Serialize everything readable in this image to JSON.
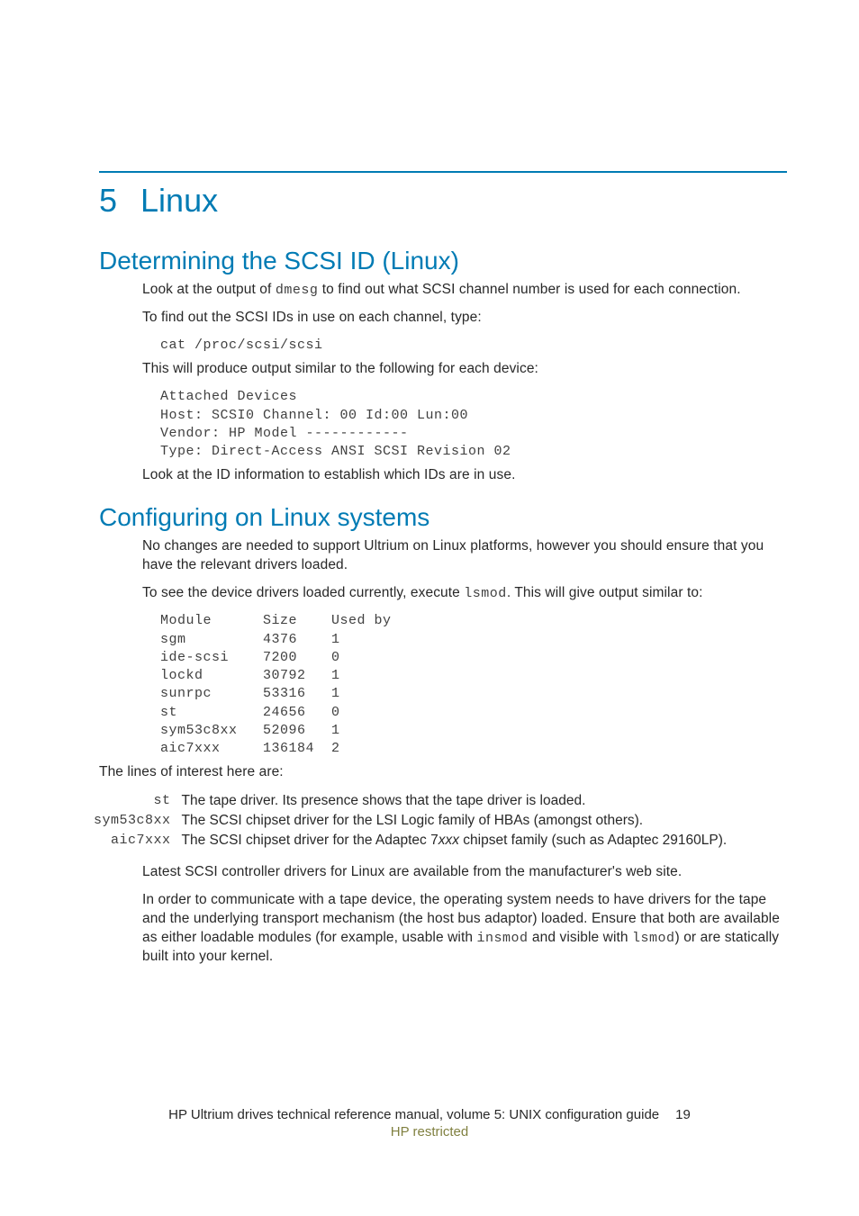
{
  "chapter": {
    "num": "5",
    "title": "Linux"
  },
  "section1": {
    "title": "Determining the SCSI ID (Linux)",
    "p1a": "Look at the output of ",
    "p1code": "dmesg",
    "p1b": " to find out what SCSI channel number is used for each connection.",
    "p2": "To find out the SCSI IDs in use on each channel, type:",
    "cmd1": "cat /proc/scsi/scsi",
    "p3": "This will produce output similar to the following for each device:",
    "output1": "Attached Devices\nHost: SCSI0 Channel: 00 Id:00 Lun:00\nVendor: HP Model ------------\nType: Direct-Access ANSI SCSI Revision 02",
    "p4": "Look at the ID information to establish which IDs are in use."
  },
  "section2": {
    "title": "Configuring on Linux systems",
    "p1": "No changes are needed to support Ultrium on Linux platforms, however you should ensure that you have the relevant drivers loaded.",
    "p2a": "To see the device drivers loaded currently, execute ",
    "p2code": "lsmod",
    "p2b": ". This will give output similar to:",
    "output2": "Module      Size    Used by\nsgm         4376    1\nide-scsi    7200    0\nlockd       30792   1\nsunrpc      53316   1\nst          24656   0\nsym53c8xx   52096   1\naic7xxx     136184  2",
    "p3": "The lines of interest here are:",
    "drivers": [
      {
        "name": "st",
        "desc_a": "The tape driver. Its presence shows that the tape driver is loaded.",
        "desc_i": "",
        "desc_b": ""
      },
      {
        "name": "sym53c8xx",
        "desc_a": "The SCSI chipset driver for the LSI Logic family of HBAs (amongst others).",
        "desc_i": "",
        "desc_b": ""
      },
      {
        "name": "aic7xxx",
        "desc_a": "The SCSI chipset driver for the Adaptec 7",
        "desc_i": "xxx",
        "desc_b": " chipset family (such as Adaptec 29160LP)."
      }
    ],
    "p4": "Latest SCSI controller drivers for Linux are available from the manufacturer's web site.",
    "p5a": "In order to communicate with a tape device, the operating system needs to have drivers for the tape and the underlying transport mechanism (the host bus adaptor) loaded. Ensure that both are available as either loadable modules (for example, usable with ",
    "p5code1": "insmod",
    "p5b": " and visible with ",
    "p5code2": "lsmod",
    "p5c": ") or are statically built into your kernel."
  },
  "footer": {
    "left": "HP Ultrium drives technical reference manual, volume 5: UNIX configuration guide",
    "page": "19",
    "restricted": "HP restricted"
  }
}
